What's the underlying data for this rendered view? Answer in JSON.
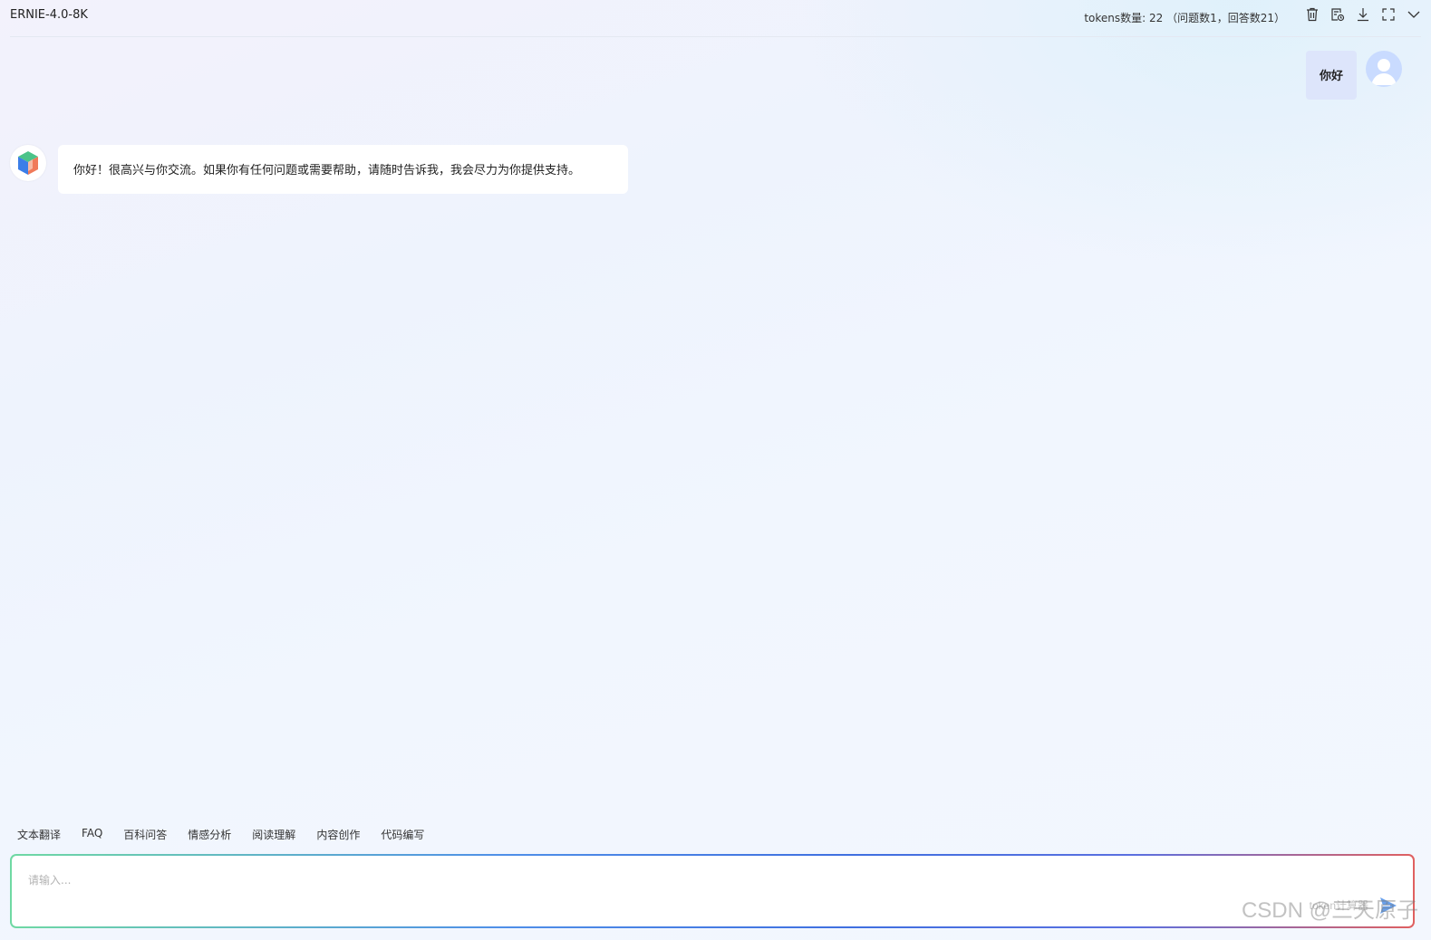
{
  "header": {
    "model_name": "ERNIE-4.0-8K",
    "token_info": "tokens数量: 22 （问题数1，回答数21）",
    "icons": [
      "clear-icon",
      "history-icon",
      "download-icon",
      "fullscreen-icon",
      "chevron-down-icon"
    ]
  },
  "messages": {
    "user": {
      "text": "你好"
    },
    "assistant": {
      "text": "你好！很高兴与你交流。如果你有任何问题或需要帮助，请随时告诉我，我会尽力为你提供支持。"
    }
  },
  "quick_prompts": [
    "文本翻译",
    "FAQ",
    "百科问答",
    "情感分析",
    "阅读理解",
    "内容创作",
    "代码编写"
  ],
  "input": {
    "placeholder": "请输入...",
    "value": ""
  },
  "watermark": {
    "brand": "CSDN @三天原子",
    "overlay": "token计算器"
  },
  "colors": {
    "user_bubble": "#dde5fb",
    "send": "#4f8fe8"
  }
}
